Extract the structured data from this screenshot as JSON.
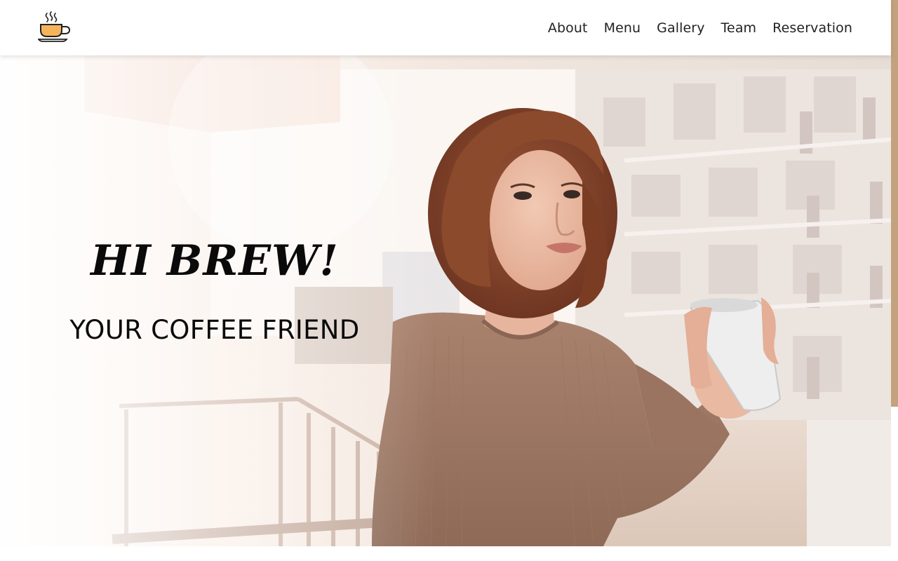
{
  "header": {
    "logo_icon": "coffee-cup-icon",
    "nav": [
      {
        "label": "About"
      },
      {
        "label": "Menu"
      },
      {
        "label": "Gallery"
      },
      {
        "label": "Team"
      },
      {
        "label": "Reservation"
      }
    ]
  },
  "hero": {
    "title": "HI BREW!",
    "subtitle": "YOUR COFFEE FRIEND",
    "image": "woman-holding-coffee-mug-on-balcony"
  },
  "colors": {
    "accent": "#c4a27f",
    "text": "#0a0a0a",
    "nav_text": "#222222",
    "cup_fill": "#f6b45a"
  }
}
